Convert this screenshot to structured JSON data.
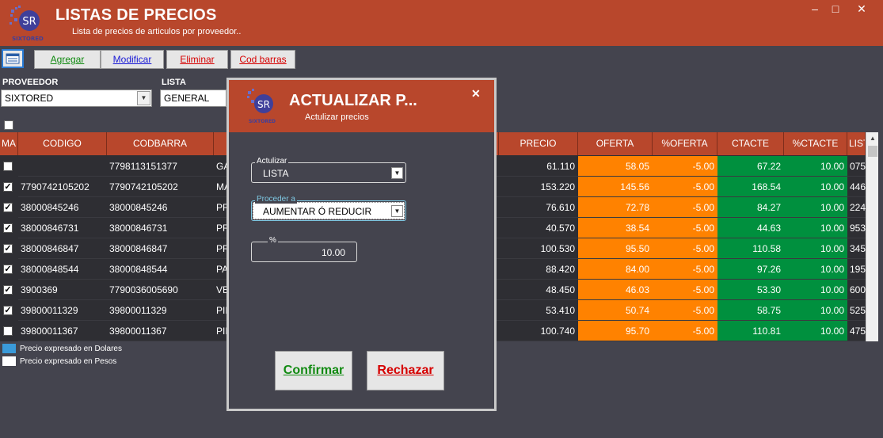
{
  "window": {
    "title": "LISTAS DE PRECIOS",
    "subtitle": "Lista de precios de articulos por proveedor..",
    "logo_text": "SIXTORED",
    "logo_initials": "SR",
    "controls": {
      "minimize": "–",
      "maximize": "□",
      "close": "✕"
    }
  },
  "toolbar": {
    "buttons": [
      {
        "label": "Agregar",
        "color": "#118a11"
      },
      {
        "label": "Modificar",
        "color": "#1a1ad6"
      },
      {
        "label": "Eliminar",
        "color": "#d60000"
      },
      {
        "label": "Cod barras",
        "color": "#d60000"
      }
    ]
  },
  "filters": {
    "proveedor_label": "PROVEEDOR",
    "proveedor_value": "SIXTORED",
    "lista_label": "LISTA",
    "lista_value": "GENERAL"
  },
  "grid": {
    "headers": [
      "MA",
      "CODIGO",
      "CODBARRA",
      "",
      "PRECIO",
      "OFERTA",
      "%OFERTA",
      "CTACTE",
      "%CTACTE",
      "LIST"
    ],
    "rows": [
      {
        "checked": false,
        "codigo": "",
        "codbarra": "7798113151377",
        "desc": "GA",
        "precio": "61.110",
        "oferta": "58.05",
        "pct_oferta": "-5.00",
        "ctacte": "67.22",
        "pct_ctacte": "10.00",
        "lista": "075"
      },
      {
        "checked": true,
        "codigo": "7790742105202",
        "codbarra": "7790742105202",
        "desc": "MA",
        "precio": "153.220",
        "oferta": "145.56",
        "pct_oferta": "-5.00",
        "ctacte": "168.54",
        "pct_ctacte": "10.00",
        "lista": "446"
      },
      {
        "checked": true,
        "codigo": "38000845246",
        "codbarra": "38000845246",
        "desc": "PR",
        "precio": "76.610",
        "oferta": "72.78",
        "pct_oferta": "-5.00",
        "ctacte": "84.27",
        "pct_ctacte": "10.00",
        "lista": "224"
      },
      {
        "checked": true,
        "codigo": "38000846731",
        "codbarra": "38000846731",
        "desc": "PR",
        "precio": "40.570",
        "oferta": "38.54",
        "pct_oferta": "-5.00",
        "ctacte": "44.63",
        "pct_ctacte": "10.00",
        "lista": "953"
      },
      {
        "checked": true,
        "codigo": "38000846847",
        "codbarra": "38000846847",
        "desc": "PR",
        "precio": "100.530",
        "oferta": "95.50",
        "pct_oferta": "-5.00",
        "ctacte": "110.58",
        "pct_ctacte": "10.00",
        "lista": "345"
      },
      {
        "checked": true,
        "codigo": "38000848544",
        "codbarra": "38000848544",
        "desc": "PA",
        "precio": "88.420",
        "oferta": "84.00",
        "pct_oferta": "-5.00",
        "ctacte": "97.26",
        "pct_ctacte": "10.00",
        "lista": "195"
      },
      {
        "checked": true,
        "codigo": "3900369",
        "codbarra": "7790036005690",
        "desc": "VE",
        "precio": "48.450",
        "oferta": "46.03",
        "pct_oferta": "-5.00",
        "ctacte": "53.30",
        "pct_ctacte": "10.00",
        "lista": "600"
      },
      {
        "checked": true,
        "codigo": "39800011329",
        "codbarra": "39800011329",
        "desc": "PII",
        "precio": "53.410",
        "oferta": "50.74",
        "pct_oferta": "-5.00",
        "ctacte": "58.75",
        "pct_ctacte": "10.00",
        "lista": "525"
      },
      {
        "checked": false,
        "codigo": "39800011367",
        "codbarra": "39800011367",
        "desc": "PII",
        "precio": "100.740",
        "oferta": "95.70",
        "pct_oferta": "-5.00",
        "ctacte": "110.81",
        "pct_ctacte": "10.00",
        "lista": "475"
      }
    ]
  },
  "legend": {
    "dolares": "Precio expresado en Dolares",
    "pesos": "Precio expresado en Pesos",
    "dolares_color": "#3a9ad9",
    "pesos_color": "#ffffff"
  },
  "modal": {
    "title": "ACTUALIZAR P...",
    "subtitle": "Actulizar precios",
    "close": "✕",
    "actualizar_label": "Actulizar",
    "actualizar_value": "LISTA",
    "proceder_label": "Proceder a",
    "proceder_value": "AUMENTAR Ó REDUCIR",
    "percent_label": "%",
    "percent_value": "10.00",
    "confirm_label": "Confirmar",
    "reject_label": "Rechazar"
  },
  "colors": {
    "accent": "#b8472c",
    "background": "#44444e",
    "oferta": "#ff8200",
    "ctacte": "#00903e"
  }
}
